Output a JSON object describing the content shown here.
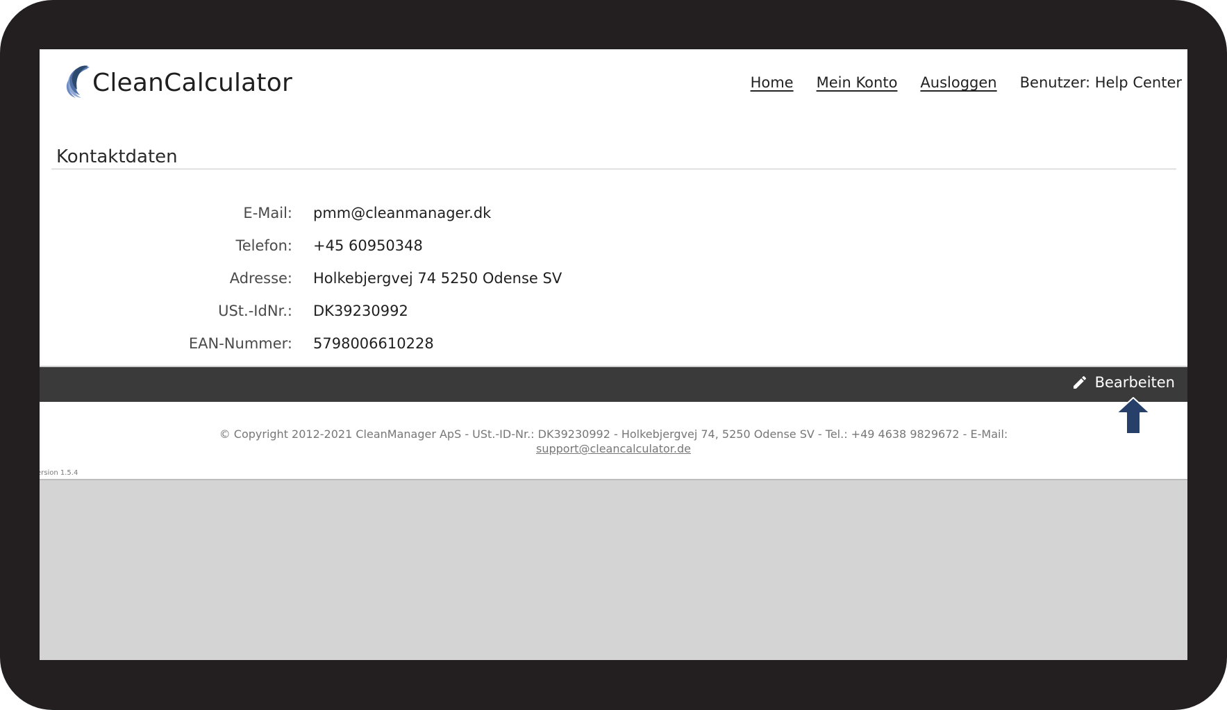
{
  "brand": {
    "name": "CleanCalculator",
    "accent": "#2c4a6e"
  },
  "nav": {
    "home": "Home",
    "account": "Mein Konto",
    "logout": "Ausloggen",
    "user": "Benutzer: Help Center"
  },
  "section": {
    "title": "Kontaktdaten"
  },
  "contact": [
    {
      "label": "E-Mail:",
      "value": "pmm@cleanmanager.dk"
    },
    {
      "label": "Telefon:",
      "value": "+45 60950348"
    },
    {
      "label": "Adresse:",
      "value": "Holkebjergvej 74 5250 Odense SV"
    },
    {
      "label": "USt.-IdNr.:",
      "value": "DK39230992"
    },
    {
      "label": "EAN-Nummer:",
      "value": "5798006610228"
    }
  ],
  "toolbar": {
    "edit_label": "Bearbeiten",
    "edit_icon": "pencil-icon"
  },
  "footer": {
    "copyright": "© Copyright 2012-2021 CleanManager ApS - USt.-ID-Nr.: DK39230992 - Holkebjergvej 74, 5250 Odense SV - Tel.: +49 4638 9829672 - E-Mail:",
    "email": "support@cleancalculator.de",
    "version": "ersion 1.5.4"
  },
  "colors": {
    "toolbar_bg": "#3a3a3a",
    "arrow": "#26406a",
    "frame": "#231f20"
  }
}
